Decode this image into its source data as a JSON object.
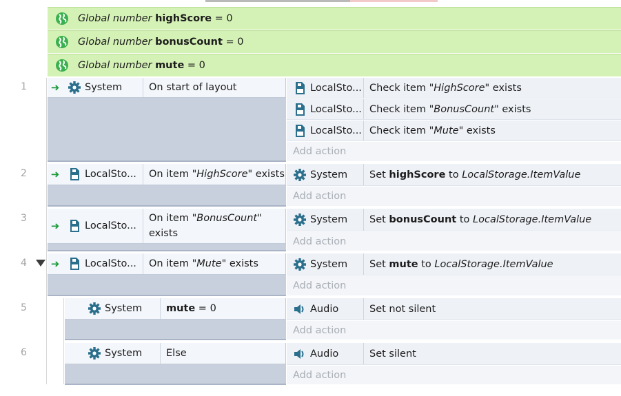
{
  "colors": {
    "global_bg": "#d5f2b6",
    "globe": "#3bb04e",
    "gear": "#2a6f8c",
    "storage": "#2a6f8c",
    "trigger": "#1a9a3a"
  },
  "globals": [
    {
      "prefix": "Global number",
      "name": "highScore",
      "value": "= 0"
    },
    {
      "prefix": "Global number",
      "name": "bonusCount",
      "value": "= 0"
    },
    {
      "prefix": "Global number",
      "name": "mute",
      "value": "= 0"
    }
  ],
  "events": [
    {
      "num": "1",
      "cond_obj": "System",
      "cond_text": "On start of layout",
      "actions": [
        {
          "obj": "LocalSto...",
          "pre": "Check item \"",
          "item": "HighScore",
          "post": "\" exists"
        },
        {
          "obj": "LocalSto...",
          "pre": "Check item \"",
          "item": "BonusCount",
          "post": "\" exists"
        },
        {
          "obj": "LocalSto...",
          "pre": "Check item \"",
          "item": "Mute",
          "post": "\" exists"
        }
      ]
    },
    {
      "num": "2",
      "cond_obj": "LocalSto...",
      "cond_pre": "On item \"",
      "cond_item": "HighScore",
      "cond_post": "\" exists",
      "act_obj": "System",
      "act_pre": "Set ",
      "act_var": "highScore",
      "act_mid": " to ",
      "act_val": "LocalStorage.ItemValue"
    },
    {
      "num": "3",
      "cond_obj": "LocalSto...",
      "cond_pre": "On item \"",
      "cond_item": "BonusCount",
      "cond_post": "\"",
      "cond_post2": "exists",
      "act_obj": "System",
      "act_pre": "Set ",
      "act_var": "bonusCount",
      "act_mid": " to ",
      "act_val": "LocalStorage.ItemValue"
    },
    {
      "num": "4",
      "cond_obj": "LocalSto...",
      "cond_pre": "On item \"",
      "cond_item": "Mute",
      "cond_post": "\" exists",
      "act_obj": "System",
      "act_pre": "Set ",
      "act_var": "mute",
      "act_mid": " to ",
      "act_val": "LocalStorage.ItemValue"
    },
    {
      "num": "5",
      "cond_obj": "System",
      "cond_var": "mute",
      "cond_rest": " = 0",
      "act_obj": "Audio",
      "act_text": "Set not silent"
    },
    {
      "num": "6",
      "cond_obj": "System",
      "cond_text": "Else",
      "act_obj": "Audio",
      "act_text": "Set silent"
    }
  ],
  "add_action": "Add action"
}
